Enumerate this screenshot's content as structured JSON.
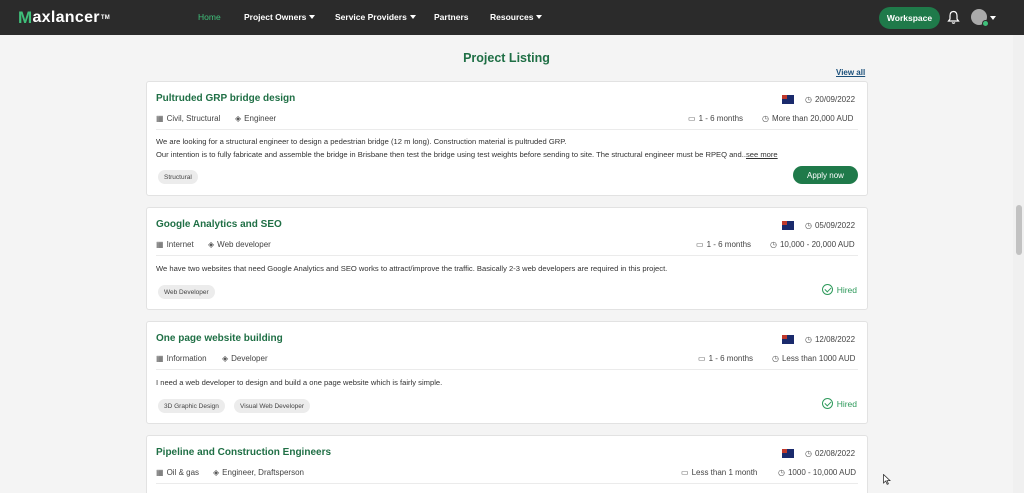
{
  "brand": {
    "logo_text": "axlancer",
    "logo_mark": "M",
    "tm": "TM"
  },
  "nav": {
    "items": [
      {
        "label": "Home",
        "active": true,
        "dropdown": false
      },
      {
        "label": "Project Owners",
        "active": false,
        "dropdown": true
      },
      {
        "label": "Service Providers",
        "active": false,
        "dropdown": true
      },
      {
        "label": "Partners",
        "active": false,
        "dropdown": false
      },
      {
        "label": "Resources",
        "active": false,
        "dropdown": true
      }
    ],
    "workspace_label": "Workspace"
  },
  "page": {
    "title": "Project Listing",
    "view_all": "View all"
  },
  "projects": [
    {
      "title": "Pultruded GRP bridge design",
      "date": "20/09/2022",
      "industry": "Civil, Structural",
      "role": "Engineer",
      "duration": "1 - 6 months",
      "budget": "More than 20,000 AUD",
      "desc_line1": "We are looking for a structural engineer to design a pedestrian bridge (12 m long). Construction material is pultruded GRP.",
      "desc_line2": "Our intention is to fully fabricate and assemble the bridge in Brisbane then test the bridge using test weights before sending to site. The structural engineer must be RPEQ and..",
      "see_more": "see more",
      "tags": [
        "Structural"
      ],
      "action": "Apply now"
    },
    {
      "title": "Google Analytics and SEO",
      "date": "05/09/2022",
      "industry": "Internet",
      "role": "Web developer",
      "duration": "1 - 6 months",
      "budget": "10,000 - 20,000 AUD",
      "desc_line1": "We have two websites that need Google Analytics and SEO works to attract/improve the traffic. Basically 2-3 web developers are required in this project.",
      "tags": [
        "Web Developer"
      ],
      "status": "Hired"
    },
    {
      "title": "One page website building",
      "date": "12/08/2022",
      "industry": "Information",
      "role": "Developer",
      "duration": "1 - 6 months",
      "budget": "Less than 1000 AUD",
      "desc_line1": "I need a web developer to design and build a one page website which is fairly simple.",
      "tags": [
        "3D Graphic Design",
        "Visual Web Developer"
      ],
      "status": "Hired"
    },
    {
      "title": "Pipeline and Construction Engineers",
      "date": "02/08/2022",
      "industry": "Oil & gas",
      "role": "Engineer,  Draftsperson",
      "duration": "Less than 1 month",
      "budget": "1000 - 10,000 AUD"
    }
  ],
  "colors": {
    "brand_green": "#1f6f45",
    "button_green": "#1f7a4a",
    "navbar": "#2b2b2b",
    "hired": "#2e9a5b"
  }
}
